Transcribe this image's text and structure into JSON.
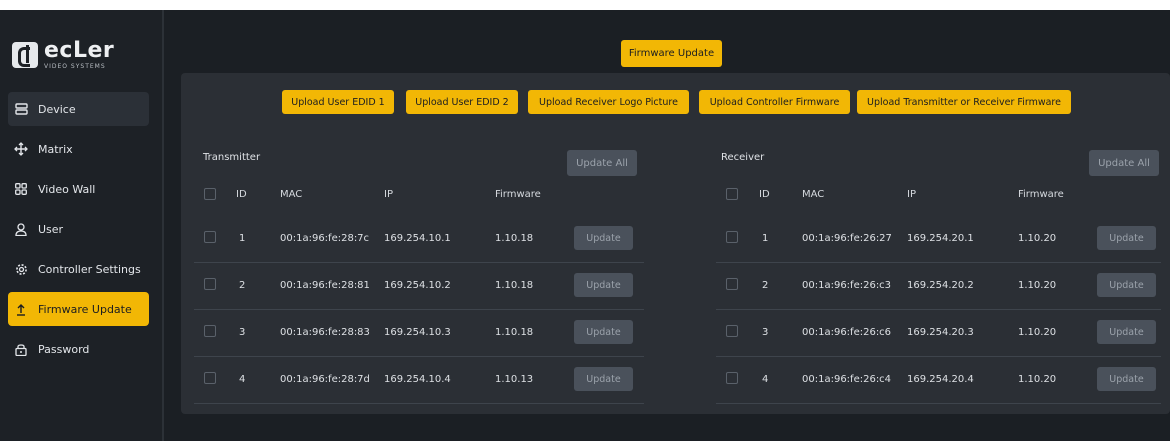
{
  "logo": {
    "brand": "ecLer",
    "sub": "VIDEO SYSTEMS"
  },
  "sidebar": {
    "items": [
      {
        "label": "Device",
        "icon": "server-icon"
      },
      {
        "label": "Matrix",
        "icon": "arrows-icon"
      },
      {
        "label": "Video Wall",
        "icon": "grid-icon"
      },
      {
        "label": "User",
        "icon": "user-icon"
      },
      {
        "label": "Controller Settings",
        "icon": "gear-icon"
      },
      {
        "label": "Firmware Update",
        "icon": "upload-icon"
      },
      {
        "label": "Password",
        "icon": "lock-icon"
      }
    ],
    "active": "Firmware Update"
  },
  "main": {
    "top_button": "Firmware Update",
    "upload_buttons": [
      "Upload User EDID 1",
      "Upload User EDID 2",
      "Upload Receiver Logo Picture",
      "Upload Controller Firmware",
      "Upload Transmitter or Receiver Firmware"
    ],
    "headers": {
      "id": "ID",
      "mac": "MAC",
      "ip": "IP",
      "firmware": "Firmware"
    },
    "update_label": "Update",
    "transmitter": {
      "title": "Transmitter",
      "update_all": "Update All",
      "rows": [
        {
          "id": "1",
          "mac": "00:1a:96:fe:28:7c",
          "ip": "169.254.10.1",
          "firmware": "1.10.18"
        },
        {
          "id": "2",
          "mac": "00:1a:96:fe:28:81",
          "ip": "169.254.10.2",
          "firmware": "1.10.18"
        },
        {
          "id": "3",
          "mac": "00:1a:96:fe:28:83",
          "ip": "169.254.10.3",
          "firmware": "1.10.18"
        },
        {
          "id": "4",
          "mac": "00:1a:96:fe:28:7d",
          "ip": "169.254.10.4",
          "firmware": "1.10.13"
        }
      ]
    },
    "receiver": {
      "title": "Receiver",
      "update_all": "Update All",
      "rows": [
        {
          "id": "1",
          "mac": "00:1a:96:fe:26:27",
          "ip": "169.254.20.1",
          "firmware": "1.10.20"
        },
        {
          "id": "2",
          "mac": "00:1a:96:fe:26:c3",
          "ip": "169.254.20.2",
          "firmware": "1.10.20"
        },
        {
          "id": "3",
          "mac": "00:1a:96:fe:26:c6",
          "ip": "169.254.20.3",
          "firmware": "1.10.20"
        },
        {
          "id": "4",
          "mac": "00:1a:96:fe:26:c4",
          "ip": "169.254.20.4",
          "firmware": "1.10.20"
        }
      ]
    }
  },
  "colors": {
    "accent": "#f2b705",
    "background": "#1b1f24",
    "panel": "#2b2f35",
    "disabled_button": "#4a515b"
  }
}
